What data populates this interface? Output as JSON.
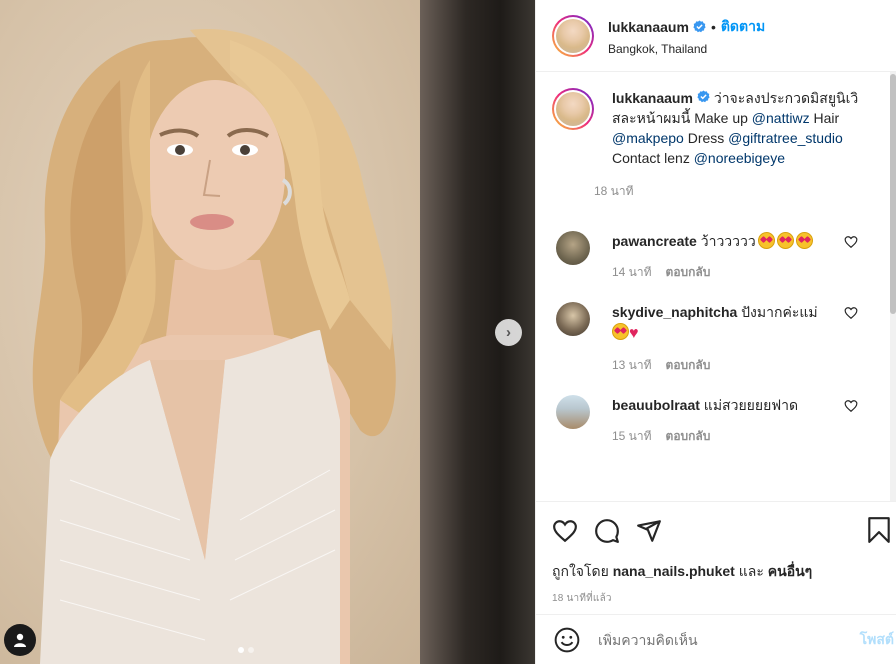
{
  "post": {
    "username": "lukkanaaum",
    "verified": true,
    "dot": "•",
    "follow_label": "ติดตาม",
    "location": "Bangkok, Thailand",
    "photo_count": 2,
    "active_photo": 1
  },
  "caption": {
    "username": "lukkanaaum",
    "text_1": " ว่าจะลงประกวดมิสยูนิเวิสละหน้าผมนี้ Make up ",
    "mention_1": "@nattiwz",
    "text_2": " Hair ",
    "mention_2": "@makpepo",
    "text_3": " Dress ",
    "mention_3": "@giftratree_studio",
    "text_4": " Contact lenz ",
    "mention_4": "@noreebigeye",
    "time": "18 นาที"
  },
  "comments": [
    {
      "username": "pawancreate",
      "text": " ว้าววววว",
      "time": "14 นาที",
      "reply": "ตอบกลับ",
      "emoji": "heart-eyes heart-eyes heart-eyes"
    },
    {
      "username": "skydive_naphitcha",
      "text": " ปังมากค่ะแม่",
      "time": "13 นาที",
      "reply": "ตอบกลับ",
      "emoji": "heart-eyes red-heart"
    },
    {
      "username": "beauubolraat",
      "text": " แม่สวยยยยฟาด",
      "time": "15 นาที",
      "reply": "ตอบกลับ"
    }
  ],
  "likes": {
    "prefix": "ถูกใจโดย ",
    "user": "nana_nails.phuket",
    "conj": " และ ",
    "others": "คนอื่นๆ"
  },
  "posted_ago": "18 นาทีที่แล้ว",
  "add_comment": {
    "placeholder": "เพิ่มความคิดเห็น",
    "post_label": "โพสต์"
  },
  "colors": {
    "accent": "#0095f6",
    "mention": "#00376b",
    "muted": "#8e8e8e"
  }
}
